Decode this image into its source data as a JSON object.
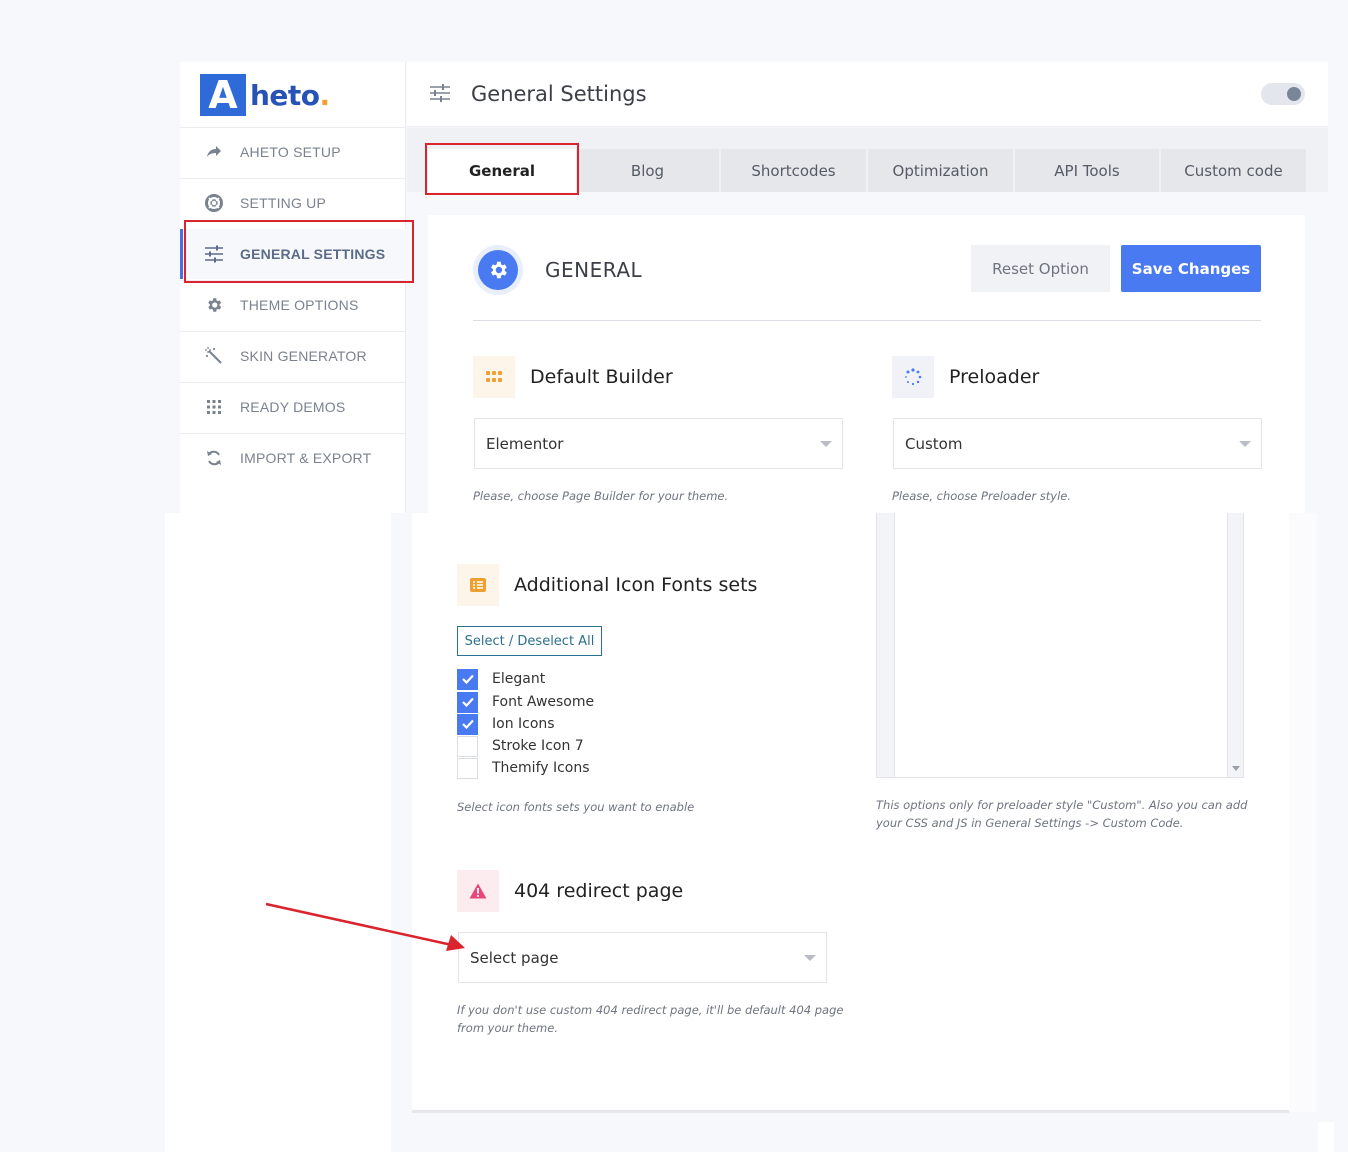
{
  "brand": {
    "logo_letter": "A",
    "logo_word": "heto",
    "logo_dot": ".",
    "primary_color": "#4a7af1",
    "annotation_color": "#d9232d"
  },
  "sidebar": {
    "items": [
      {
        "label": "AHETO SETUP",
        "icon": "arrow-share-icon"
      },
      {
        "label": "SETTING UP",
        "icon": "lifebuoy-icon"
      },
      {
        "label": "GENERAL SETTINGS",
        "icon": "sliders-icon",
        "active": true
      },
      {
        "label": "THEME OPTIONS",
        "icon": "gear-icon"
      },
      {
        "label": "SKIN GENERATOR",
        "icon": "magic-wand-icon"
      },
      {
        "label": "READY DEMOS",
        "icon": "grid-dots-icon"
      },
      {
        "label": "IMPORT & EXPORT",
        "icon": "sync-icon"
      }
    ]
  },
  "header": {
    "title": "General Settings",
    "icon": "sliders-icon",
    "toggle_on": true
  },
  "tabs": [
    {
      "label": "General",
      "active": true
    },
    {
      "label": "Blog"
    },
    {
      "label": "Shortcodes"
    },
    {
      "label": "Optimization"
    },
    {
      "label": "API Tools"
    },
    {
      "label": "Custom code"
    }
  ],
  "panel": {
    "heading": "GENERAL",
    "reset_label": "Reset Option",
    "save_label": "Save Changes"
  },
  "default_builder": {
    "title": "Default Builder",
    "value": "Elementor",
    "hint": "Please, choose Page Builder for your theme."
  },
  "preloader": {
    "title": "Preloader",
    "value": "Custom",
    "hint": "Please, choose Preloader style.",
    "note_line1": "This options only for preloader style \"Custom\". Also you can add",
    "note_line2": "your CSS and JS in General Settings -> Custom Code."
  },
  "icon_fonts": {
    "title": "Additional Icon Fonts sets",
    "select_all_label": "Select / Deselect All",
    "options": [
      {
        "label": "Elegant",
        "checked": true
      },
      {
        "label": "Font Awesome",
        "checked": true
      },
      {
        "label": "Ion Icons",
        "checked": true
      },
      {
        "label": "Stroke Icon 7",
        "checked": false
      },
      {
        "label": "Themify Icons",
        "checked": false
      }
    ],
    "hint": "Select icon fonts sets you want to enable"
  },
  "redirect": {
    "title": "404 redirect page",
    "value": "Select page",
    "hint_line1": "If you don't use custom 404 redirect page, it'll be default 404 page",
    "hint_line2": "from your theme."
  }
}
